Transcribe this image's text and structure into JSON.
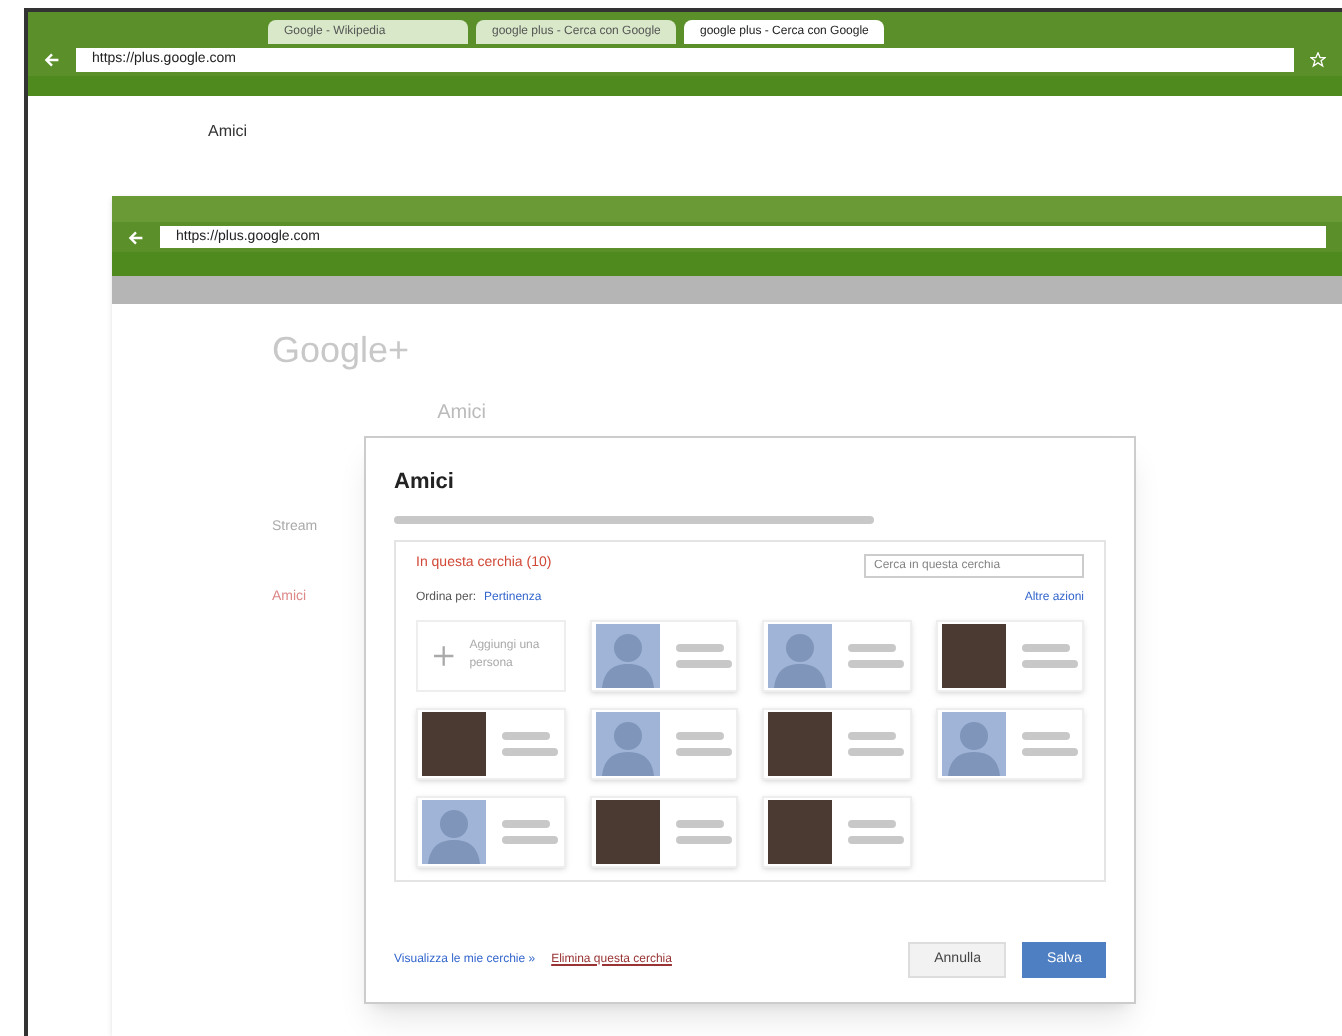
{
  "back_window": {
    "tabs": [
      {
        "label": "Google - Wikipedia",
        "selected": false
      },
      {
        "label": "google plus - Cerca con Google",
        "selected": false
      },
      {
        "label": "google plus - Cerca con Google",
        "selected": true
      }
    ],
    "address": "https://plus.google.com",
    "page_link": "Amici"
  },
  "front_window": {
    "address": "https://plus.google.com",
    "logo": "Google+",
    "page_title": "Amici",
    "sidebar": [
      {
        "label": "Stream",
        "selected": false
      },
      {
        "label": "Amici",
        "selected": true
      }
    ]
  },
  "dialog": {
    "title": "Amici",
    "circle_heading": "In questa cerchia (10)",
    "search": {
      "placeholder": "Cerca in questa cerchia"
    },
    "sort_label": "Ordina per:",
    "sort_value": "Pertinenza",
    "more_actions": "Altre azioni",
    "add_person": "Aggiungi una persona",
    "contacts": [
      {
        "kind": "silhouette"
      },
      {
        "kind": "silhouette"
      },
      {
        "kind": "photo"
      },
      {
        "kind": "photo"
      },
      {
        "kind": "silhouette"
      },
      {
        "kind": "photo"
      },
      {
        "kind": "silhouette"
      },
      {
        "kind": "silhouette"
      },
      {
        "kind": "photo"
      },
      {
        "kind": "photo"
      }
    ],
    "view_link": "Visualizza le mie cerchie »",
    "delete_link": "Elimina questa cerchia",
    "buttons": [
      {
        "label": "Annulla",
        "primary": false
      },
      {
        "label": "Salva",
        "primary": true
      }
    ]
  }
}
